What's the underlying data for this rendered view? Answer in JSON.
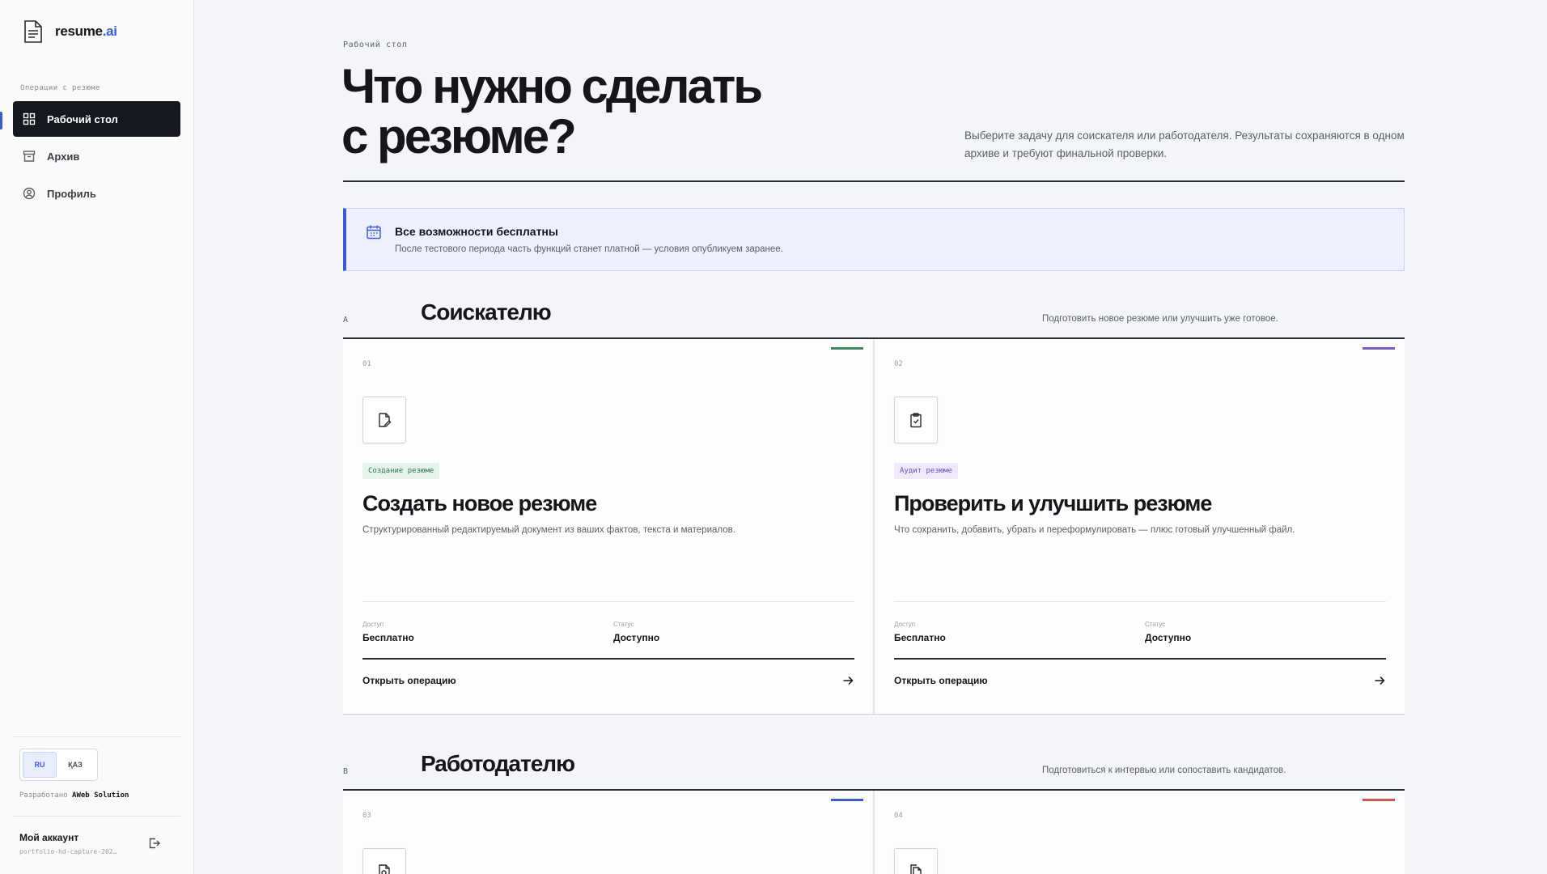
{
  "sidebar": {
    "logo": {
      "name": "resume",
      "accent": ".ai"
    },
    "section_label": "Операции с резюме",
    "items": [
      {
        "label": "Рабочий стол",
        "icon": "grid-icon",
        "active": true
      },
      {
        "label": "Архив",
        "icon": "archive-icon",
        "active": false
      },
      {
        "label": "Профиль",
        "icon": "user-circle-icon",
        "active": false
      }
    ],
    "languages": [
      {
        "label": "RU",
        "selected": true
      },
      {
        "label": "ҚАЗ",
        "selected": false
      }
    ],
    "developer": {
      "prefix": "Разработано",
      "name": "AWeb Solution"
    },
    "account": {
      "title": "Мой аккаунт",
      "subtitle": "portfolio-hd-capture-202…"
    }
  },
  "header": {
    "breadcrumb": "Рабочий стол",
    "title_line1": "Что нужно сделать",
    "title_line2": "с резюме?",
    "description": "Выберите задачу для соискателя или работодателя. Результаты сохраняются в одном архиве и требуют финальной проверки."
  },
  "notice": {
    "title": "Все возможности бесплатны",
    "text": "После тестового периода часть функций станет платной — условия опубликуем заранее."
  },
  "sections": [
    {
      "letter": "A",
      "title": "Соискателю",
      "description": "Подготовить новое резюме или улучшить уже готовое.",
      "cards": [
        {
          "number": "01",
          "icon": "document-edit-icon",
          "tag": "Создание резюме",
          "title": "Создать новое резюме",
          "description": "Структурированный редактируемый документ из ваших фактов, текста и материалов.",
          "access_label": "Доступ",
          "access_value": "Бесплатно",
          "status_label": "Статус",
          "status_value": "Доступно",
          "action": "Открыть операцию"
        },
        {
          "number": "02",
          "icon": "clipboard-check-icon",
          "tag": "Аудит резюме",
          "title": "Проверить и улучшить резюме",
          "description": "Что сохранить, добавить, убрать и переформулировать — плюс готовый улучшенный файл.",
          "access_label": "Доступ",
          "access_value": "Бесплатно",
          "status_label": "Статус",
          "status_value": "Доступно",
          "action": "Открыть операцию"
        }
      ]
    },
    {
      "letter": "B",
      "title": "Работодателю",
      "description": "Подготовиться к интервью или сопоставить кандидатов.",
      "cards": [
        {
          "number": "03",
          "icon": "document-search-icon"
        },
        {
          "number": "04",
          "icon": "documents-compare-icon"
        }
      ]
    }
  ],
  "colors": {
    "brand": "#3d5bd8",
    "card_accent_1": "#3f8a5e",
    "card_accent_2": "#7a5ac8",
    "card_accent_3": "#3d5bd8",
    "card_accent_4": "#d0584e",
    "tag_green_bg": "#e6f3ea",
    "tag_green_fg": "#2f7a4e",
    "tag_purple_bg": "#efe9fb",
    "tag_purple_fg": "#6a4bb8"
  }
}
